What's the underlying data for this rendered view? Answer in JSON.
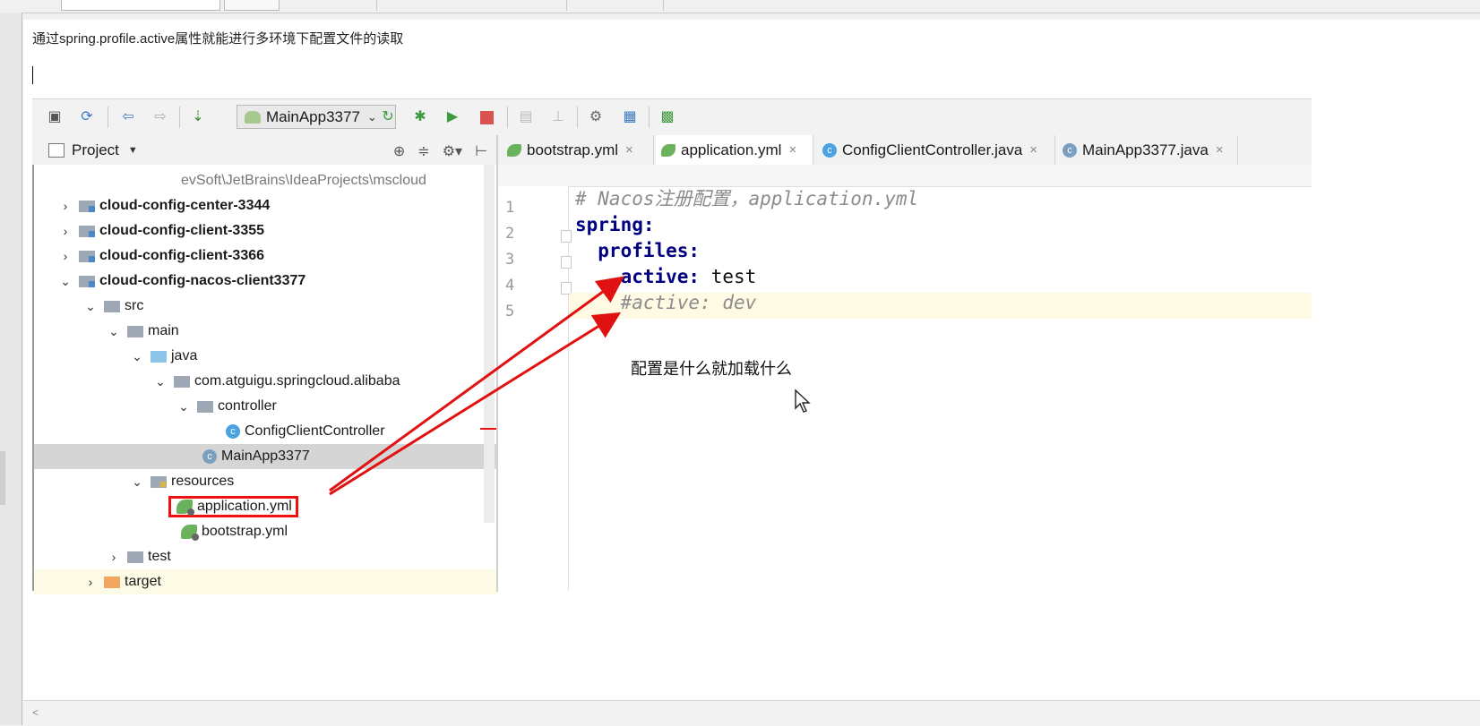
{
  "caption": "通过spring.profile.active属性就能进行多环境下配置文件的读取",
  "annotation_note": "配置是什么就加载什么",
  "toolbar": {
    "run_config": "MainApp3377",
    "icons": [
      "save-icon",
      "sync-icon",
      "back-icon",
      "forward-icon",
      "build-icon",
      "run-icon",
      "debug-icon",
      "coverage-icon",
      "stop-icon",
      "attach-icon",
      "profile-icon",
      "structure-icon",
      "sdk-icon",
      "plugin-icon"
    ]
  },
  "project_panel": {
    "title": "Project",
    "path": "evSoft\\JetBrains\\IdeaProjects\\mscloud",
    "items": [
      {
        "label": "cloud-config-center-3344",
        "type": "module",
        "expanded": false
      },
      {
        "label": "cloud-config-client-3355",
        "type": "module",
        "expanded": false
      },
      {
        "label": "cloud-config-client-3366",
        "type": "module",
        "expanded": false
      },
      {
        "label": "cloud-config-nacos-client3377",
        "type": "module",
        "expanded": true
      },
      {
        "label": "src",
        "type": "folder",
        "expanded": true
      },
      {
        "label": "main",
        "type": "folder",
        "expanded": true
      },
      {
        "label": "java",
        "type": "source-folder",
        "expanded": true
      },
      {
        "label": "com.atguigu.springcloud.alibaba",
        "type": "package",
        "expanded": true
      },
      {
        "label": "controller",
        "type": "package",
        "expanded": true
      },
      {
        "label": "ConfigClientController",
        "type": "class"
      },
      {
        "label": "MainApp3377",
        "type": "spring-class",
        "selected": true
      },
      {
        "label": "resources",
        "type": "resource-folder",
        "expanded": true
      },
      {
        "label": "application.yml",
        "type": "yml",
        "highlighted": true
      },
      {
        "label": "bootstrap.yml",
        "type": "yml"
      },
      {
        "label": "test",
        "type": "folder",
        "expanded": false
      },
      {
        "label": "target",
        "type": "excluded-folder",
        "expanded": false
      }
    ]
  },
  "editor": {
    "tabs": [
      {
        "label": "bootstrap.yml",
        "icon": "yml-icon",
        "active": false
      },
      {
        "label": "application.yml",
        "icon": "yml-icon",
        "active": true
      },
      {
        "label": "ConfigClientController.java",
        "icon": "class-icon",
        "active": false
      },
      {
        "label": "MainApp3377.java",
        "icon": "spring-class-icon",
        "active": false
      }
    ],
    "lines": [
      {
        "num": "1",
        "text": "# Nacos注册配置，application.yml"
      },
      {
        "num": "2",
        "key": "spring:"
      },
      {
        "num": "3",
        "key": "  profiles:"
      },
      {
        "num": "4",
        "key": "    active:",
        "value": " test"
      },
      {
        "num": "5",
        "text": "    #active: dev"
      }
    ]
  },
  "colors": {
    "annotation_red": "#e11111",
    "yaml_key": "#000080",
    "comment": "#8c8c8c",
    "caret_line": "#fffae3"
  }
}
